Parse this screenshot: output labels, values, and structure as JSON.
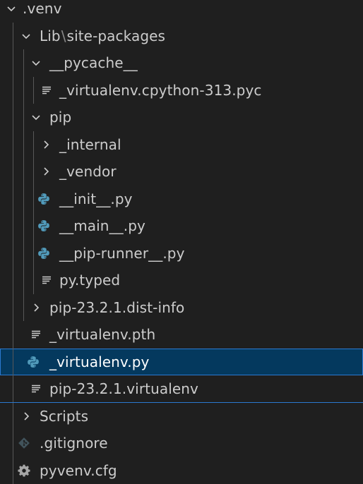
{
  "explorer": {
    "colors": {
      "background": "#1f1f1f",
      "selected": "#04395e",
      "focus_border": "#2b79d0",
      "python_icon": "#519aba",
      "text": "#cccccc"
    },
    "items": [
      {
        "label": ".venv",
        "icon": "chevron-down-icon"
      },
      {
        "label": "Lib",
        "separator": "\\",
        "label2": "site-packages",
        "icon": "chevron-down-icon"
      },
      {
        "label": "__pycache__",
        "icon": "chevron-down-icon"
      },
      {
        "label": "_virtualenv.cpython-313.pyc",
        "icon": "file-lines-icon"
      },
      {
        "label": "pip",
        "icon": "chevron-down-icon"
      },
      {
        "label": "_internal",
        "icon": "chevron-right-icon"
      },
      {
        "label": "_vendor",
        "icon": "chevron-right-icon"
      },
      {
        "label": "__init__.py",
        "icon": "python-icon"
      },
      {
        "label": "__main__.py",
        "icon": "python-icon"
      },
      {
        "label": "__pip-runner__.py",
        "icon": "python-icon"
      },
      {
        "label": "py.typed",
        "icon": "file-lines-icon"
      },
      {
        "label": "pip-23.2.1.dist-info",
        "icon": "chevron-right-icon"
      },
      {
        "label": "_virtualenv.pth",
        "icon": "file-lines-icon"
      },
      {
        "label": "_virtualenv.py",
        "icon": "python-icon",
        "selected": true
      },
      {
        "label": "pip-23.2.1.virtualenv",
        "icon": "file-lines-icon"
      },
      {
        "label": "Scripts",
        "icon": "chevron-right-icon"
      },
      {
        "label": ".gitignore",
        "icon": "git-icon"
      },
      {
        "label": "pyvenv.cfg",
        "icon": "gear-icon"
      }
    ]
  }
}
